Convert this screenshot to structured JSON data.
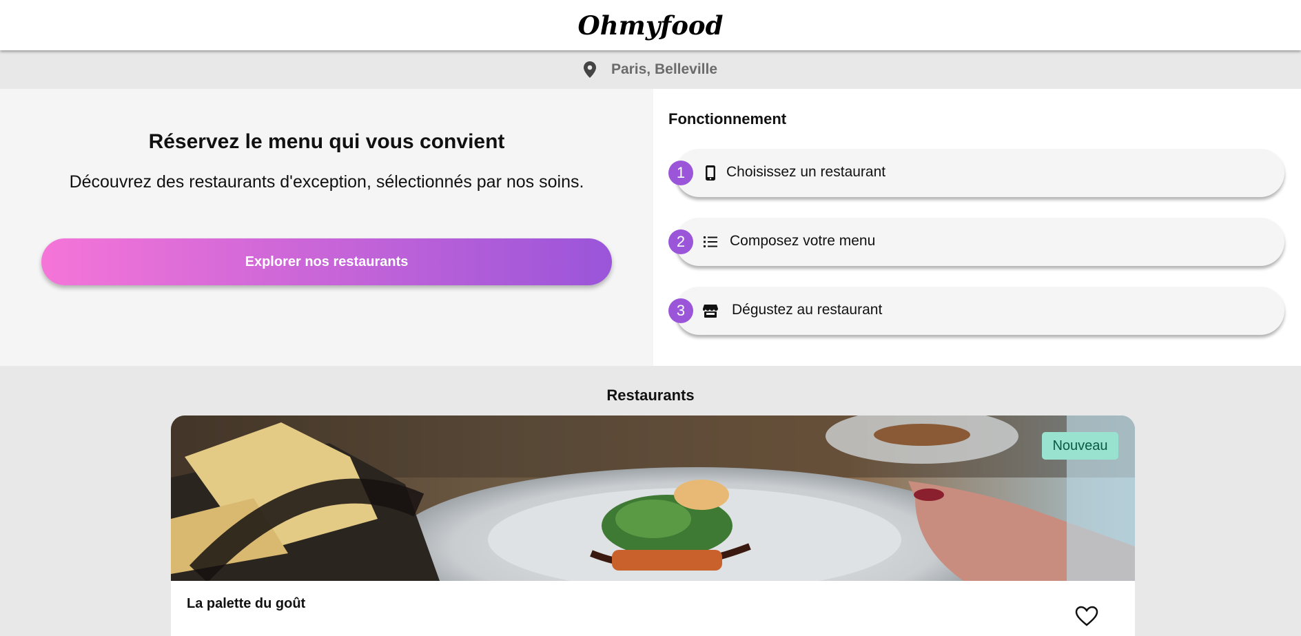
{
  "header": {
    "logo": "Ohmyfood"
  },
  "location": {
    "icon": "map-pin-icon",
    "text": "Paris, Belleville"
  },
  "hero": {
    "title": "Réservez le menu qui vous convient",
    "subtitle": "Découvrez des restaurants d'exception, sélectionnés par nos soins.",
    "cta_label": "Explorer nos restaurants"
  },
  "how_it_works": {
    "title": "Fonctionnement",
    "steps": [
      {
        "number": "1",
        "icon": "mobile-phone-icon",
        "label": "Choisissez un restaurant"
      },
      {
        "number": "2",
        "icon": "list-icon",
        "label": "Composez votre menu"
      },
      {
        "number": "3",
        "icon": "store-icon",
        "label": "Dégustez au restaurant"
      }
    ]
  },
  "restaurants": {
    "title": "Restaurants",
    "items": [
      {
        "name": "La palette du goût",
        "badge": "Nouveau",
        "favorite_icon": "heart-icon"
      }
    ]
  },
  "colors": {
    "accent_purple": "#9a55d9",
    "gradient_start": "#f575d8",
    "gradient_end": "#9a55d9",
    "badge_bg": "#99e2d0",
    "badge_text": "#0a5a43"
  }
}
